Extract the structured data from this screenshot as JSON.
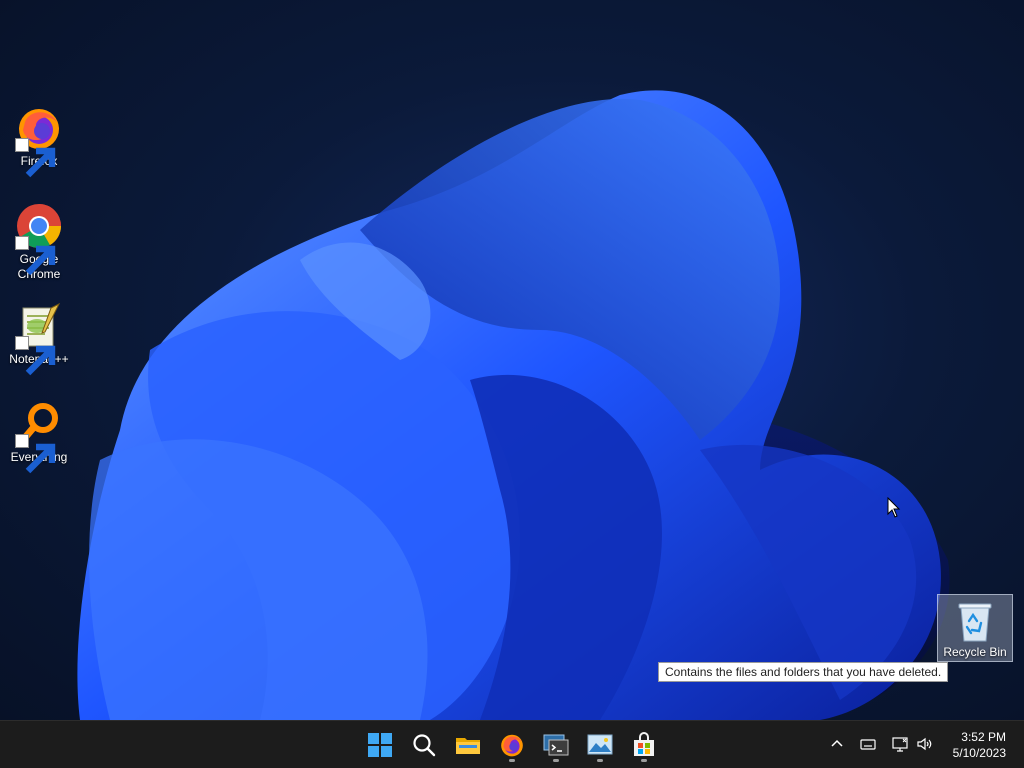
{
  "desktop": {
    "icons": [
      {
        "label": "Firefox",
        "icon": "firefox-icon"
      },
      {
        "label": "Google Chrome",
        "icon": "chrome-icon"
      },
      {
        "label": "Notepad++",
        "icon": "notepadpp-icon"
      },
      {
        "label": "Everything",
        "icon": "everything-search-icon"
      }
    ],
    "recycle_bin": {
      "label": "Recycle Bin",
      "icon": "recycle-bin-icon"
    },
    "tooltip": "Contains the files and folders that you have deleted."
  },
  "taskbar": {
    "apps": [
      {
        "icon": "windows-start-icon",
        "running": false
      },
      {
        "icon": "search-icon",
        "running": false
      },
      {
        "icon": "file-explorer-icon",
        "running": false
      },
      {
        "icon": "firefox-icon",
        "running": true
      },
      {
        "icon": "terminal-icon",
        "running": true
      },
      {
        "icon": "image-viewer-icon",
        "running": true
      },
      {
        "icon": "store-icon",
        "running": true
      }
    ],
    "tray": {
      "icons": [
        "chevron-up-icon",
        "keyboard-icon",
        "network-icon",
        "volume-icon"
      ]
    },
    "clock": {
      "time": "3:52 PM",
      "date": "5/10/2023"
    }
  },
  "colors": {
    "taskbar_bg": "#1c1c1c",
    "wallpaper_blue": "#1e52ff",
    "desktop_dark": "#0b1a3a"
  }
}
